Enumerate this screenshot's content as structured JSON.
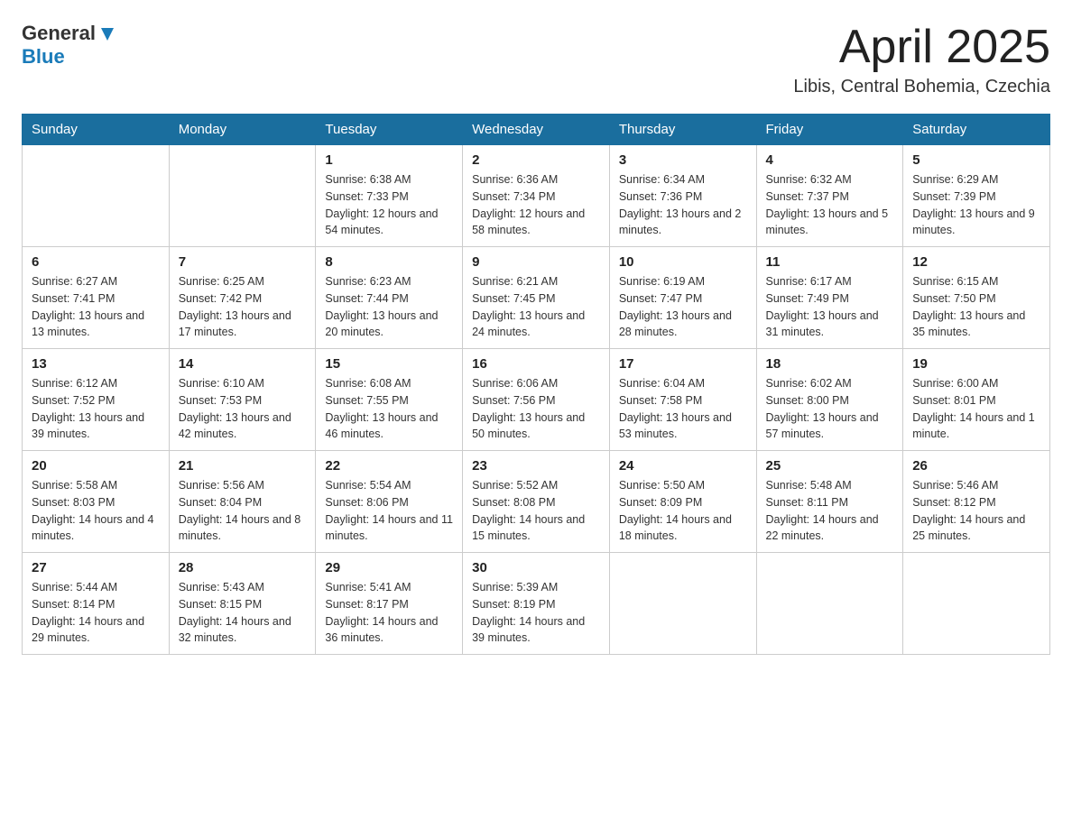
{
  "header": {
    "logo_general": "General",
    "logo_blue": "Blue",
    "title": "April 2025",
    "subtitle": "Libis, Central Bohemia, Czechia"
  },
  "days_of_week": [
    "Sunday",
    "Monday",
    "Tuesday",
    "Wednesday",
    "Thursday",
    "Friday",
    "Saturday"
  ],
  "weeks": [
    [
      {
        "day": "",
        "sunrise": "",
        "sunset": "",
        "daylight": ""
      },
      {
        "day": "",
        "sunrise": "",
        "sunset": "",
        "daylight": ""
      },
      {
        "day": "1",
        "sunrise": "Sunrise: 6:38 AM",
        "sunset": "Sunset: 7:33 PM",
        "daylight": "Daylight: 12 hours and 54 minutes."
      },
      {
        "day": "2",
        "sunrise": "Sunrise: 6:36 AM",
        "sunset": "Sunset: 7:34 PM",
        "daylight": "Daylight: 12 hours and 58 minutes."
      },
      {
        "day": "3",
        "sunrise": "Sunrise: 6:34 AM",
        "sunset": "Sunset: 7:36 PM",
        "daylight": "Daylight: 13 hours and 2 minutes."
      },
      {
        "day": "4",
        "sunrise": "Sunrise: 6:32 AM",
        "sunset": "Sunset: 7:37 PM",
        "daylight": "Daylight: 13 hours and 5 minutes."
      },
      {
        "day": "5",
        "sunrise": "Sunrise: 6:29 AM",
        "sunset": "Sunset: 7:39 PM",
        "daylight": "Daylight: 13 hours and 9 minutes."
      }
    ],
    [
      {
        "day": "6",
        "sunrise": "Sunrise: 6:27 AM",
        "sunset": "Sunset: 7:41 PM",
        "daylight": "Daylight: 13 hours and 13 minutes."
      },
      {
        "day": "7",
        "sunrise": "Sunrise: 6:25 AM",
        "sunset": "Sunset: 7:42 PM",
        "daylight": "Daylight: 13 hours and 17 minutes."
      },
      {
        "day": "8",
        "sunrise": "Sunrise: 6:23 AM",
        "sunset": "Sunset: 7:44 PM",
        "daylight": "Daylight: 13 hours and 20 minutes."
      },
      {
        "day": "9",
        "sunrise": "Sunrise: 6:21 AM",
        "sunset": "Sunset: 7:45 PM",
        "daylight": "Daylight: 13 hours and 24 minutes."
      },
      {
        "day": "10",
        "sunrise": "Sunrise: 6:19 AM",
        "sunset": "Sunset: 7:47 PM",
        "daylight": "Daylight: 13 hours and 28 minutes."
      },
      {
        "day": "11",
        "sunrise": "Sunrise: 6:17 AM",
        "sunset": "Sunset: 7:49 PM",
        "daylight": "Daylight: 13 hours and 31 minutes."
      },
      {
        "day": "12",
        "sunrise": "Sunrise: 6:15 AM",
        "sunset": "Sunset: 7:50 PM",
        "daylight": "Daylight: 13 hours and 35 minutes."
      }
    ],
    [
      {
        "day": "13",
        "sunrise": "Sunrise: 6:12 AM",
        "sunset": "Sunset: 7:52 PM",
        "daylight": "Daylight: 13 hours and 39 minutes."
      },
      {
        "day": "14",
        "sunrise": "Sunrise: 6:10 AM",
        "sunset": "Sunset: 7:53 PM",
        "daylight": "Daylight: 13 hours and 42 minutes."
      },
      {
        "day": "15",
        "sunrise": "Sunrise: 6:08 AM",
        "sunset": "Sunset: 7:55 PM",
        "daylight": "Daylight: 13 hours and 46 minutes."
      },
      {
        "day": "16",
        "sunrise": "Sunrise: 6:06 AM",
        "sunset": "Sunset: 7:56 PM",
        "daylight": "Daylight: 13 hours and 50 minutes."
      },
      {
        "day": "17",
        "sunrise": "Sunrise: 6:04 AM",
        "sunset": "Sunset: 7:58 PM",
        "daylight": "Daylight: 13 hours and 53 minutes."
      },
      {
        "day": "18",
        "sunrise": "Sunrise: 6:02 AM",
        "sunset": "Sunset: 8:00 PM",
        "daylight": "Daylight: 13 hours and 57 minutes."
      },
      {
        "day": "19",
        "sunrise": "Sunrise: 6:00 AM",
        "sunset": "Sunset: 8:01 PM",
        "daylight": "Daylight: 14 hours and 1 minute."
      }
    ],
    [
      {
        "day": "20",
        "sunrise": "Sunrise: 5:58 AM",
        "sunset": "Sunset: 8:03 PM",
        "daylight": "Daylight: 14 hours and 4 minutes."
      },
      {
        "day": "21",
        "sunrise": "Sunrise: 5:56 AM",
        "sunset": "Sunset: 8:04 PM",
        "daylight": "Daylight: 14 hours and 8 minutes."
      },
      {
        "day": "22",
        "sunrise": "Sunrise: 5:54 AM",
        "sunset": "Sunset: 8:06 PM",
        "daylight": "Daylight: 14 hours and 11 minutes."
      },
      {
        "day": "23",
        "sunrise": "Sunrise: 5:52 AM",
        "sunset": "Sunset: 8:08 PM",
        "daylight": "Daylight: 14 hours and 15 minutes."
      },
      {
        "day": "24",
        "sunrise": "Sunrise: 5:50 AM",
        "sunset": "Sunset: 8:09 PM",
        "daylight": "Daylight: 14 hours and 18 minutes."
      },
      {
        "day": "25",
        "sunrise": "Sunrise: 5:48 AM",
        "sunset": "Sunset: 8:11 PM",
        "daylight": "Daylight: 14 hours and 22 minutes."
      },
      {
        "day": "26",
        "sunrise": "Sunrise: 5:46 AM",
        "sunset": "Sunset: 8:12 PM",
        "daylight": "Daylight: 14 hours and 25 minutes."
      }
    ],
    [
      {
        "day": "27",
        "sunrise": "Sunrise: 5:44 AM",
        "sunset": "Sunset: 8:14 PM",
        "daylight": "Daylight: 14 hours and 29 minutes."
      },
      {
        "day": "28",
        "sunrise": "Sunrise: 5:43 AM",
        "sunset": "Sunset: 8:15 PM",
        "daylight": "Daylight: 14 hours and 32 minutes."
      },
      {
        "day": "29",
        "sunrise": "Sunrise: 5:41 AM",
        "sunset": "Sunset: 8:17 PM",
        "daylight": "Daylight: 14 hours and 36 minutes."
      },
      {
        "day": "30",
        "sunrise": "Sunrise: 5:39 AM",
        "sunset": "Sunset: 8:19 PM",
        "daylight": "Daylight: 14 hours and 39 minutes."
      },
      {
        "day": "",
        "sunrise": "",
        "sunset": "",
        "daylight": ""
      },
      {
        "day": "",
        "sunrise": "",
        "sunset": "",
        "daylight": ""
      },
      {
        "day": "",
        "sunrise": "",
        "sunset": "",
        "daylight": ""
      }
    ]
  ]
}
